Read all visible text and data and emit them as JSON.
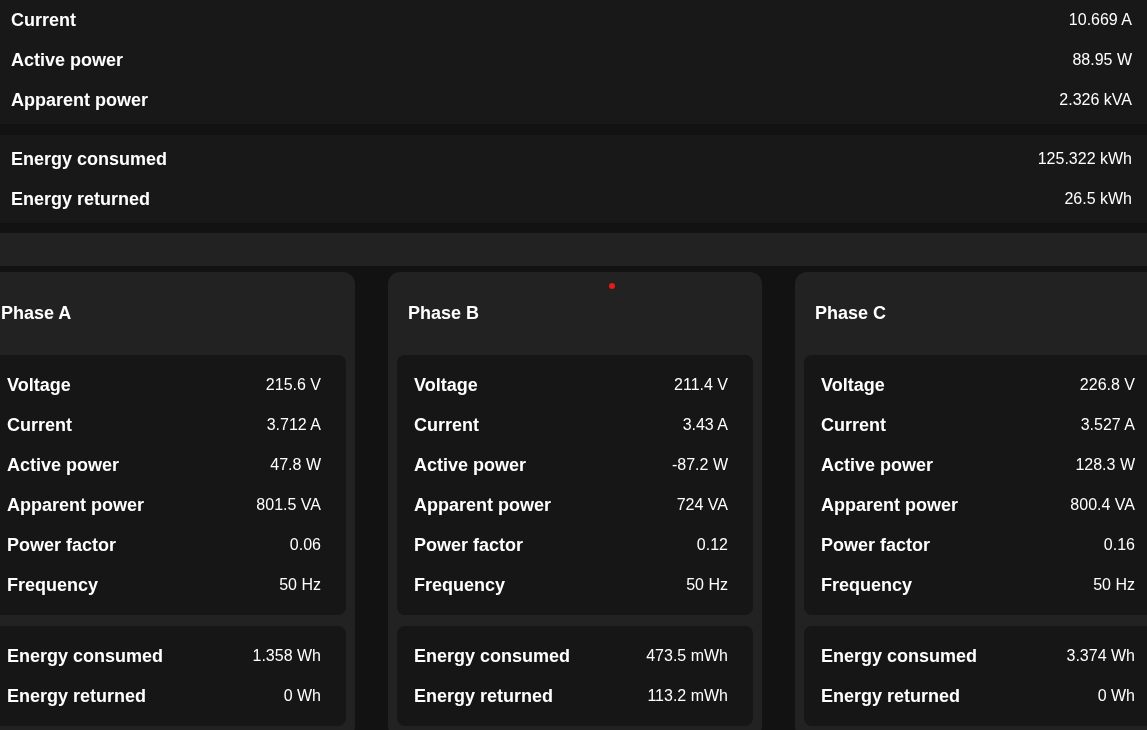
{
  "summary": [
    {
      "rows": [
        {
          "label": "Current",
          "value": "10.669 A"
        },
        {
          "label": "Active power",
          "value": "88.95 W"
        },
        {
          "label": "Apparent power",
          "value": "2.326 kVA"
        }
      ]
    },
    {
      "rows": [
        {
          "label": "Energy consumed",
          "value": "125.322 kWh"
        },
        {
          "label": "Energy returned",
          "value": "26.5 kWh"
        }
      ]
    }
  ],
  "phases": [
    {
      "title": "Phase A",
      "indicator": false,
      "measurements": [
        {
          "label": "Voltage",
          "value": "215.6 V"
        },
        {
          "label": "Current",
          "value": "3.712 A"
        },
        {
          "label": "Active power",
          "value": "47.8 W"
        },
        {
          "label": "Apparent power",
          "value": "801.5 VA"
        },
        {
          "label": "Power factor",
          "value": "0.06"
        },
        {
          "label": "Frequency",
          "value": "50 Hz"
        }
      ],
      "energy": [
        {
          "label": "Energy consumed",
          "value": "1.358 Wh"
        },
        {
          "label": "Energy returned",
          "value": "0 Wh"
        }
      ]
    },
    {
      "title": "Phase B",
      "indicator": true,
      "measurements": [
        {
          "label": "Voltage",
          "value": "211.4 V"
        },
        {
          "label": "Current",
          "value": "3.43 A"
        },
        {
          "label": "Active power",
          "value": "-87.2 W"
        },
        {
          "label": "Apparent power",
          "value": "724 VA"
        },
        {
          "label": "Power factor",
          "value": "0.12"
        },
        {
          "label": "Frequency",
          "value": "50 Hz"
        }
      ],
      "energy": [
        {
          "label": "Energy consumed",
          "value": "473.5 mWh"
        },
        {
          "label": "Energy returned",
          "value": "113.2 mWh"
        }
      ]
    },
    {
      "title": "Phase C",
      "indicator": false,
      "measurements": [
        {
          "label": "Voltage",
          "value": "226.8 V"
        },
        {
          "label": "Current",
          "value": "3.527 A"
        },
        {
          "label": "Active power",
          "value": "128.3 W"
        },
        {
          "label": "Apparent power",
          "value": "800.4 VA"
        },
        {
          "label": "Power factor",
          "value": "0.16"
        },
        {
          "label": "Frequency",
          "value": "50 Hz"
        }
      ],
      "energy": [
        {
          "label": "Energy consumed",
          "value": "3.374 Wh"
        },
        {
          "label": "Energy returned",
          "value": "0 Wh"
        }
      ]
    }
  ]
}
